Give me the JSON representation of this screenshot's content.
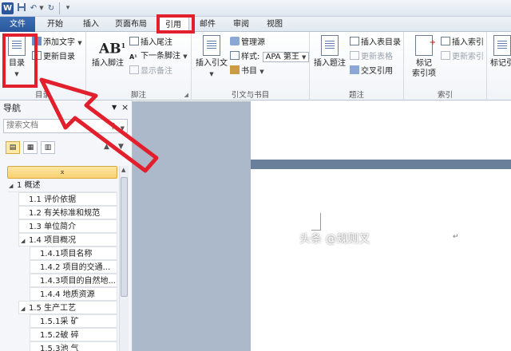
{
  "titlebar": {
    "app_icon_label": "W",
    "qat_separator": "|",
    "icons": [
      "word-app-icon",
      "save-icon",
      "undo-icon",
      "redo-icon",
      "customize-qat-icon"
    ]
  },
  "tabs": {
    "file": "文件",
    "home": "开始",
    "insert": "插入",
    "layout": "页面布局",
    "references": "引用",
    "mailings": "邮件",
    "review": "审阅",
    "view": "视图"
  },
  "ribbon": {
    "toc_group": {
      "toc_button": "目录",
      "add_text": "添加文字",
      "update_toc": "更新目录",
      "label": "目录"
    },
    "footnote_group": {
      "insert_footnote": "插入脚注",
      "insert_endnote": "插入尾注",
      "next_footnote": "下一条脚注",
      "show_notes": "显示备注",
      "label": "脚注"
    },
    "citation_group": {
      "insert_citation": "插入引文",
      "manage_sources": "管理源",
      "style_label": "样式:",
      "style_value": "APA 第王",
      "bibliography": "书目",
      "label": "引文与书目"
    },
    "caption_group": {
      "insert_caption": "插入题注",
      "insert_table_of_figures": "插入表目录",
      "update_table": "更新表格",
      "cross_reference": "交叉引用",
      "label": "题注"
    },
    "index_group": {
      "mark_entry_line1": "标记",
      "mark_entry_line2": "索引项",
      "insert_index": "插入索引",
      "update_index": "更新索引",
      "label": "索引"
    },
    "toa_group": {
      "mark_citation": "标记引"
    }
  },
  "nav": {
    "title": "导航",
    "search_placeholder": "搜索文档",
    "tree": [
      {
        "level": 1,
        "expanded": true,
        "text": "1  概述"
      },
      {
        "level": 2,
        "text": "1.1  评价依据"
      },
      {
        "level": 2,
        "text": "1.2  有关标准和规范"
      },
      {
        "level": 2,
        "text": "1.3  单位简介"
      },
      {
        "level": 2,
        "expanded": true,
        "text": "1.4  项目概况"
      },
      {
        "level": 3,
        "text": "1.4.1项目名称"
      },
      {
        "level": 3,
        "text": "1.4.2  项目的交通..."
      },
      {
        "level": 3,
        "text": "1.4.3项目的自然地..."
      },
      {
        "level": 3,
        "text": "1.4.4   地质资源"
      },
      {
        "level": 2,
        "expanded": true,
        "text": "1.5  生产工艺"
      },
      {
        "level": 3,
        "text": "1.5.1采  矿"
      },
      {
        "level": 3,
        "text": "1.5.2破  碎"
      },
      {
        "level": 3,
        "text": "1.5.3池  气"
      }
    ]
  },
  "document": {
    "para_mark": "↵"
  },
  "watermark": "头条 @规则叉",
  "colors": {
    "highlight_red": "#e2202d",
    "file_tab_blue": "#2b579a",
    "doc_background": "#abb9ca"
  }
}
